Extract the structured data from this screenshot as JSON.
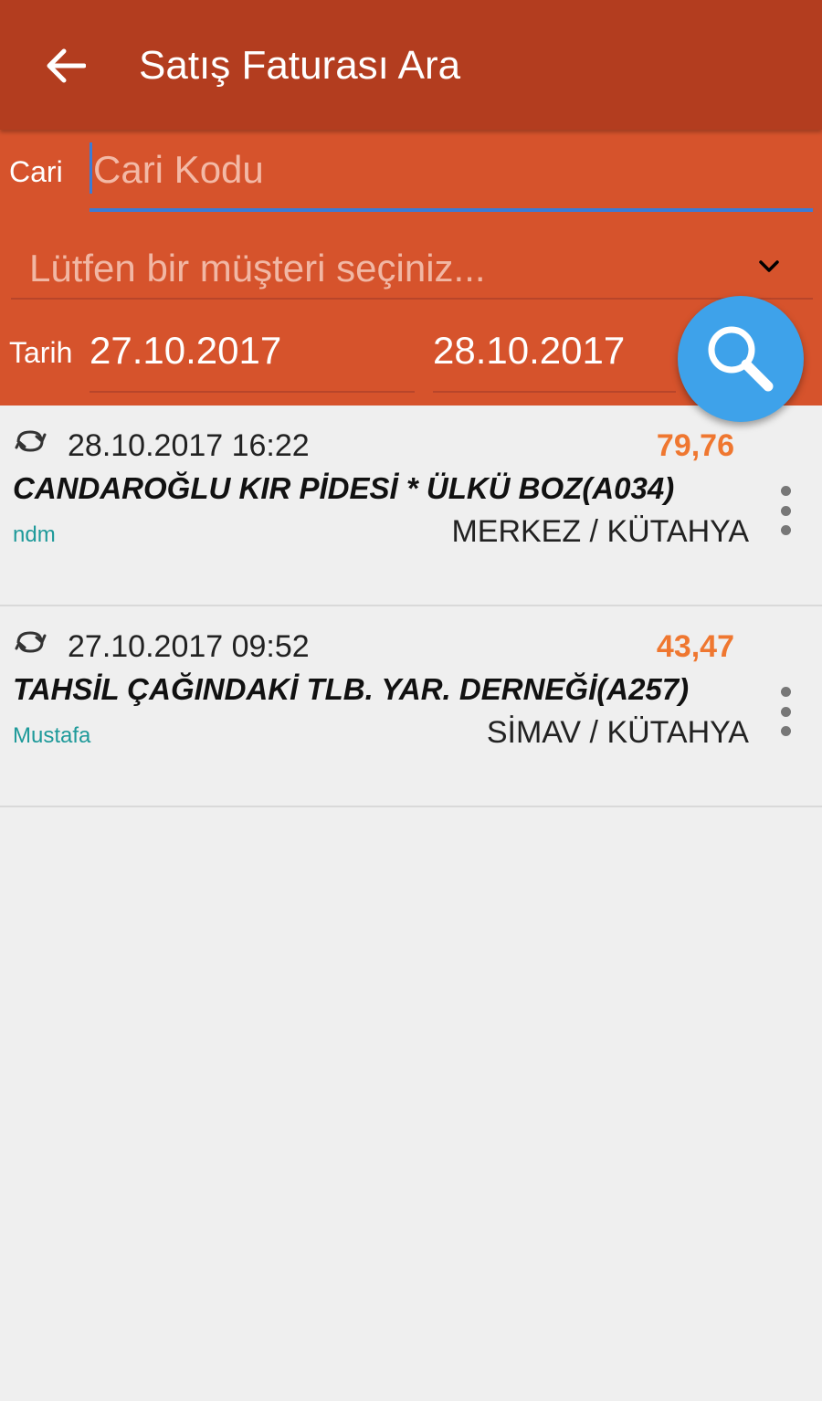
{
  "app_bar": {
    "title": "Satış Faturası Ara",
    "back_icon": "arrow-left-icon"
  },
  "filters": {
    "cari_label": "Cari",
    "cari_placeholder": "Cari Kodu",
    "cari_value": "",
    "customer_select_placeholder": "Lütfen bir müşteri seçiniz...",
    "tarih_label": "Tarih",
    "date_from": "27.10.2017",
    "date_to": "28.10.2017",
    "search_icon": "search-icon"
  },
  "invoices": [
    {
      "datetime": "28.10.2017 16:22",
      "amount": "79,76",
      "customer": "CANDAROĞLU KIR PİDESİ * ÜLKÜ BOZ(A034)",
      "user": "ndm",
      "location": "MERKEZ / KÜTAHYA"
    },
    {
      "datetime": "27.10.2017 09:52",
      "amount": "43,47",
      "customer": "TAHSİL ÇAĞINDAKİ TLB. YAR. DERNEĞİ(A257)",
      "user": "Mustafa",
      "location": "SİMAV / KÜTAHYA"
    }
  ],
  "colors": {
    "app_bar": "#b33d1f",
    "filter_panel": "#d6532c",
    "fab": "#3ea2ea",
    "amount": "#ef7730",
    "user": "#1e9a9a"
  }
}
